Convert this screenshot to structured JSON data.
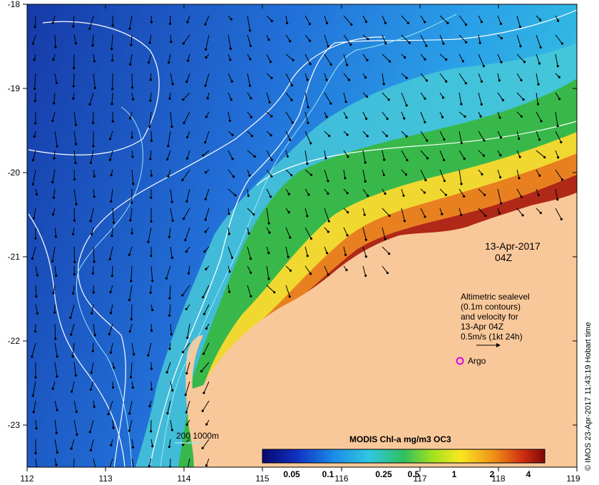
{
  "map": {
    "lon_ticks": [
      "112",
      "113",
      "114",
      "115",
      "116",
      "117",
      "118",
      "119"
    ],
    "lat_ticks": [
      "-18",
      "-19",
      "-20",
      "-21",
      "-22",
      "-23"
    ],
    "date_line1": "13-Apr-2017",
    "date_line2": "04Z",
    "legend_text": [
      "Altimetric sealevel",
      "(0.1m contours)",
      "and velocity for",
      "13-Apr 04Z",
      "0.5m/s (1kt 24h)"
    ],
    "argo_label": "Argo",
    "depth_legend": "200  1000m",
    "colorbar_title": "MODIS Chl-a mg/m3 OC3",
    "colorbar_ticks": [
      "0.05",
      "0.1",
      "0.25",
      "0.5",
      "1",
      "2",
      "4"
    ],
    "credit": "© IMOS 23-Apr-2017 11:43:19 Hobart time"
  },
  "colors": {
    "land": "#f9c89a",
    "ocean_deep": "#1a3fb0",
    "ocean_mid": "#2f86e0",
    "shelf": "#5ec8d8",
    "coastal_green": "#4cc44a",
    "coastal_yellow": "#f0d030",
    "coastal_orange": "#e07820",
    "coastal_red": "#b02818",
    "argo": "#e000e0",
    "contour": "#ffffff",
    "isobath": "#9ee8f0"
  }
}
